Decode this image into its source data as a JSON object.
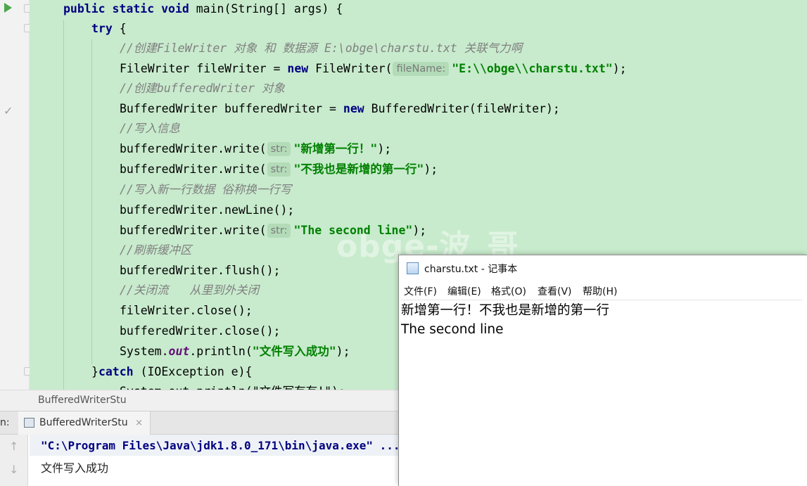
{
  "editor": {
    "lines": {
      "main_kw": "public static void",
      "main_rest": " main(String[] args) {",
      "try_kw": "try",
      "try_rest": " {",
      "c1": "//创建FileWriter 对象 和 数据源 E:\\obge\\charstu.txt 关联气力啊",
      "l2_a": "FileWriter fileWriter = ",
      "l2_new": "new",
      "l2_b": " FileWriter(",
      "l2_hint": "fileName:",
      "l2_str": "\"E:\\\\obge\\\\charstu.txt\"",
      "l2_end": ");",
      "c2": "//创建bufferedWriter 对象",
      "l4_a": "BufferedWriter bufferedWriter = ",
      "l4_new": "new",
      "l4_b": " BufferedWriter(fileWriter);",
      "c3": "//写入信息",
      "w1_a": "bufferedWriter.write(",
      "w1_hint": "str:",
      "w1_str": "\"新增第一行！\"",
      "w1_end": ");",
      "w2_a": "bufferedWriter.write(",
      "w2_hint": "str:",
      "w2_str": "\"不我也是新增的第一行\"",
      "w2_end": ");",
      "c4": "//写入新一行数据 俗称换一行写",
      "nl": "bufferedWriter.newLine();",
      "w3_a": "bufferedWriter.write(",
      "w3_hint": "str:",
      "w3_str": "\"The second line\"",
      "w3_end": ");",
      "c5": "//刷新缓冲区",
      "flush": "bufferedWriter.flush();",
      "c6": "//关闭流   从里到外关闭",
      "close1": "fileWriter.close();",
      "close2": "bufferedWriter.close();",
      "println_a": "System.",
      "println_out": "out",
      "println_b": ".println(",
      "println_str": "\"文件写入成功\"",
      "println_end": ");",
      "catch_a": "}",
      "catch_kw": "catch",
      "catch_b": " (IOException e){",
      "last_partial": "System.out.println(\"文件写有有!\");"
    },
    "watermark": "obge-波_哥"
  },
  "breadcrumb": "BufferedWriterStu",
  "run": {
    "prefix": "n:",
    "tab_label": "BufferedWriterStu",
    "tab_close": "×"
  },
  "console": {
    "command": "\"C:\\Program Files\\Java\\jdk1.8.0_171\\bin\\java.exe\" ...",
    "output": "文件写入成功"
  },
  "notepad": {
    "title": "charstu.txt - 记事本",
    "menu": [
      "文件(F)",
      "编辑(E)",
      "格式(O)",
      "查看(V)",
      "帮助(H)"
    ],
    "content": [
      "新增第一行！不我也是新增的第一行",
      "The second line"
    ]
  },
  "icons": {
    "run": "run-triangle-icon",
    "fold": "fold-icon",
    "check": "check-icon",
    "console_up": "arrow-up-icon",
    "console_down": "arrow-down-icon",
    "notepad": "notepad-icon"
  },
  "colors": {
    "code_bg": "#c8ebcd",
    "keyword": "#000080",
    "string": "#008000",
    "comment": "#808080"
  }
}
